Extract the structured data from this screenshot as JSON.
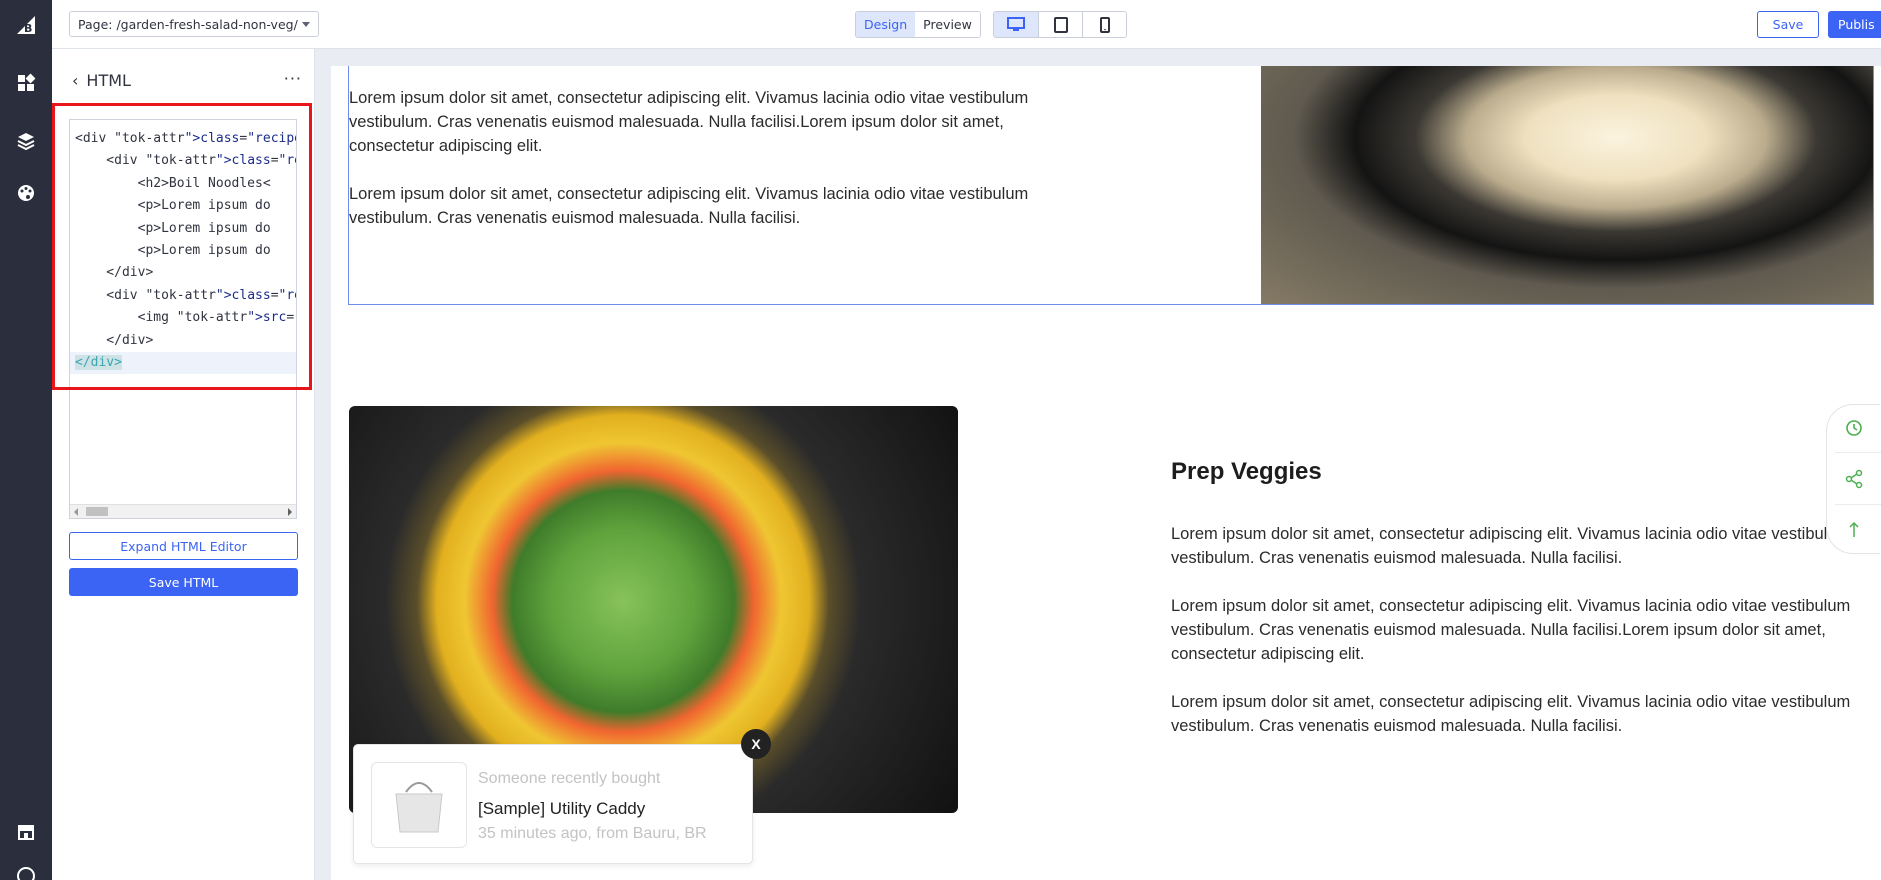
{
  "topbar": {
    "page_selector": "Page: /garden-fresh-salad-non-veg/",
    "modes": [
      "Design",
      "Preview"
    ],
    "active_mode": "Design",
    "devices": [
      "desktop-icon",
      "tablet-icon",
      "mobile-icon"
    ],
    "active_device": "desktop-icon",
    "save_label": "Save",
    "publish_label": "Publis"
  },
  "rail": {
    "items": [
      "dashboard-icon",
      "layers-icon",
      "palette-icon",
      "storefront-icon",
      "help-icon"
    ]
  },
  "panel": {
    "back_label": "‹",
    "title": "HTML",
    "more_label": "···",
    "code": [
      "<div class=\"recipes-secti",
      "    <div class=\"recipes-s",
      "        <h2>Boil Noodles<",
      "        <p>Lorem ipsum do",
      "        <p>Lorem ipsum do",
      "        <p>Lorem ipsum do",
      "    </div>",
      "    <div class=\"recipes-s",
      "        <img src=\"https:/",
      "    </div>",
      "</div>"
    ],
    "expand_label": "Expand HTML Editor",
    "save_html_label": "Save HTML"
  },
  "canvas": {
    "section1": {
      "paragraphs": [
        "Lorem ipsum dolor sit amet, consectetur adipiscing elit. Vivamus lacinia odio vitae vestibulum vestibulum. Cras venenatis euismod malesuada. Nulla facilisi.Lorem ipsum dolor sit amet, consectetur adipiscing elit.",
        "Lorem ipsum dolor sit amet, consectetur adipiscing elit. Vivamus lacinia odio vitae vestibulum vestibulum. Cras venenatis euismod malesuada. Nulla facilisi."
      ]
    },
    "section2": {
      "title": "Prep Veggies",
      "paragraphs": [
        "Lorem ipsum dolor sit amet, consectetur adipiscing elit. Vivamus lacinia odio vitae vestibulum vestibulum. Cras venenatis euismod malesuada. Nulla facilisi.",
        "Lorem ipsum dolor sit amet, consectetur adipiscing elit. Vivamus lacinia odio vitae vestibulum vestibulum. Cras venenatis euismod malesuada. Nulla facilisi.Lorem ipsum dolor sit amet, consectetur adipiscing elit.",
        "Lorem ipsum dolor sit amet, consectetur adipiscing elit. Vivamus lacinia odio vitae vestibulum vestibulum. Cras venenatis euismod malesuada. Nulla facilisi."
      ]
    }
  },
  "popup": {
    "headline": "Someone recently bought",
    "product": "[Sample] Utility Caddy",
    "when": "35 minutes ago, from Bauru, BR",
    "close_label": "X"
  },
  "floaters": [
    "history-icon",
    "share-icon",
    "arrow-up-icon"
  ],
  "colors": {
    "accent": "#3c64f4",
    "rail_bg": "#2b2f3d",
    "highlight_outline": "#e8151b",
    "floater_icon": "#4caf50"
  }
}
